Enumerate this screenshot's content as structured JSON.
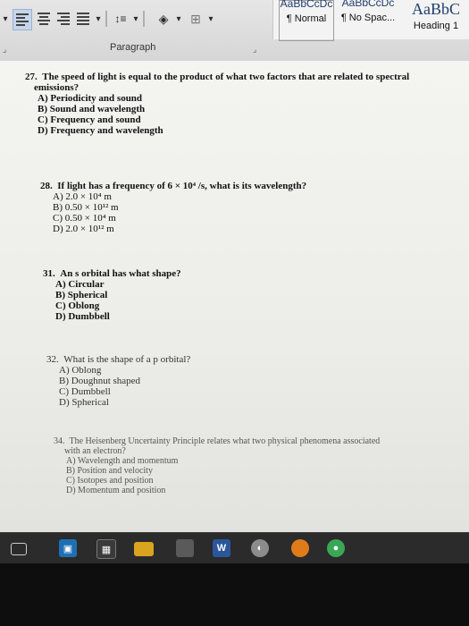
{
  "ribbon": {
    "styles": [
      {
        "preview": "AaBbCcDc",
        "name": "¶ Normal"
      },
      {
        "preview": "AaBbCcDc",
        "name": "¶ No Spac..."
      },
      {
        "preview": "AaBbC",
        "name": "Heading 1"
      }
    ],
    "group_label": "Paragraph"
  },
  "questions": [
    {
      "number": "27.",
      "text_line1": "The speed of light is equal to the product of what two factors that are related to spectral",
      "text_line2": "emissions?",
      "options": [
        "A)  Periodicity and sound",
        "B)  Sound and wavelength",
        "C)  Frequency and sound",
        "D)  Frequency and wavelength"
      ]
    },
    {
      "number": "28.",
      "text": "If light has a frequency of 6 × 10⁴ /s, what is its wavelength?",
      "options": [
        "A)  2.0 × 10⁴ m",
        "B)  0.50 × 10¹² m",
        "C)  0.50 × 10⁴ m",
        "D)  2.0 × 10¹² m"
      ]
    },
    {
      "number": "31.",
      "text": "An s orbital has what shape?",
      "options": [
        "A)  Circular",
        "B)  Spherical",
        "C)  Oblong",
        "D)  Dumbbell"
      ]
    },
    {
      "number": "32.",
      "text": "What is the shape of a p orbital?",
      "options": [
        "A)  Oblong",
        "B)  Doughnut shaped",
        "C)  Dumbbell",
        "D)  Spherical"
      ]
    },
    {
      "number": "34.",
      "text_line1": "The Heisenberg Uncertainty Principle relates what two physical phenomena associated",
      "text_line2": "with an electron?",
      "options": [
        "A)  Wavelength and momentum",
        "B)  Position and velocity",
        "C)  Isotopes and position",
        "D)  Momentum and position"
      ]
    }
  ],
  "taskbar": {
    "icons": [
      "task-view-icon",
      "store-icon",
      "calculator-icon",
      "folder-icon",
      "word-icon",
      "edge-icon",
      "firefox-icon",
      "chrome-icon"
    ]
  },
  "colors": {
    "ribbon_bg": "#dcdcdc",
    "page_bg": "#efefec",
    "taskbar_bg": "#2b2b2b",
    "word_blue": "#2b579a"
  }
}
